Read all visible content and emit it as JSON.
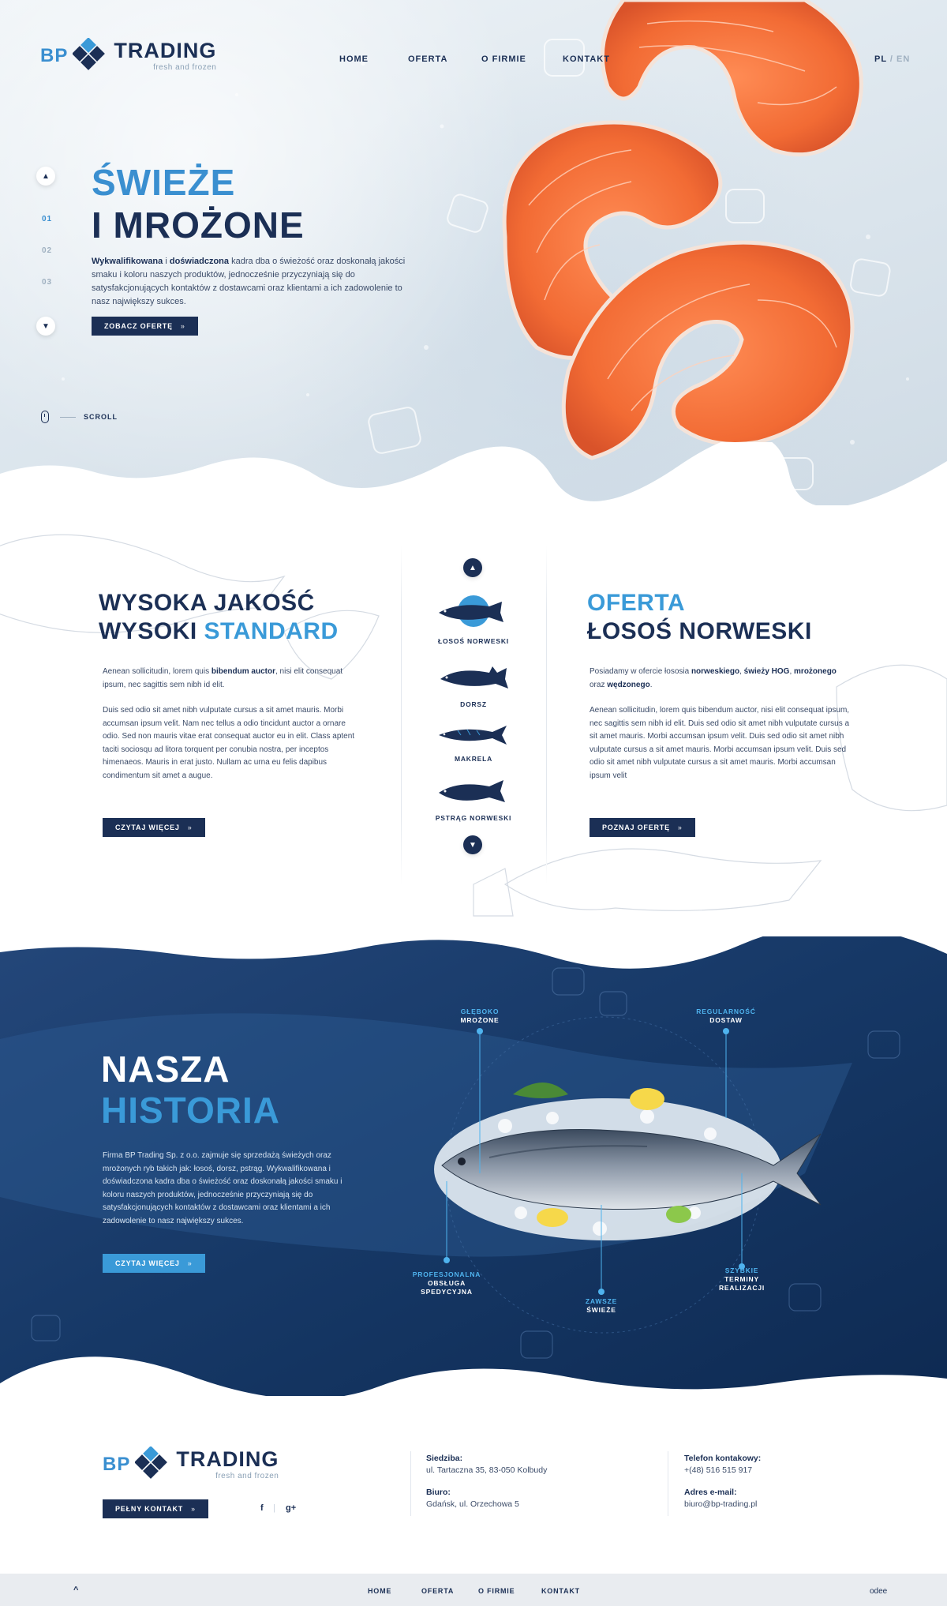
{
  "brand": {
    "bp": "BP",
    "trading": "TRADING",
    "tagline": "fresh and frozen",
    "colors": {
      "navy": "#1b2f55",
      "accent": "#3a9ad8",
      "light_accent": "#4fb3ee"
    }
  },
  "nav": {
    "items": [
      "HOME",
      "OFERTA",
      "O FIRMIE",
      "KONTAKT"
    ],
    "lang_pl": "PL",
    "lang_sep": "/",
    "lang_en": "EN"
  },
  "hero": {
    "title_line1": "ŚWIEŻE",
    "title_line2": "I MROŻONE",
    "text_bold1": "Wykwalifikowana",
    "text_mid1": " i ",
    "text_bold2": "doświadczona",
    "text_rest": " kadra dba o świeżość oraz doskonałą jakości smaku i koloru naszych produktów, jednocześnie przyczyniają się do satysfakcjonujących kontaktów z dostawcami oraz klientami a ich zadowolenie to nasz największy sukces.",
    "button": "ZOBACZ OFERTĘ",
    "slides": [
      "01",
      "02",
      "03"
    ],
    "scroll_label": "SCROLL"
  },
  "quality": {
    "title_line1": "WYSOKA JAKOŚĆ",
    "title_line2a": "WYSOKI ",
    "title_line2b": "STANDARD",
    "p1_start": "Aenean sollicitudin, lorem quis ",
    "p1_bold": "bibendum auctor",
    "p1_end": ", nisi elit consequat ipsum, nec sagittis sem nibh id elit.",
    "p2": "Duis sed odio sit amet nibh vulputate cursus a sit amet mauris. Morbi accumsan ipsum velit. Nam nec tellus a odio tincidunt auctor a ornare odio. Sed non  mauris vitae erat consequat auctor eu in elit. Class aptent taciti sociosqu ad litora torquent per conubia nostra, per inceptos himenaeos.  Mauris in erat justo. Nullam ac urna eu felis dapibus condimentum sit amet a augue.",
    "button": "CZYTAJ WIĘCEJ"
  },
  "fish": [
    "ŁOSOŚ NORWESKI",
    "DORSZ",
    "MAKRELA",
    "PSTRĄG NORWESKI"
  ],
  "offer": {
    "title_line1": "OFERTA",
    "title_line2": "ŁOSOŚ NORWESKI",
    "p1_a": "Posiadamy w ofercie łososia ",
    "p1_b": "norweskiego",
    "p1_c": ", ",
    "p1_d": "świeży HOG",
    "p1_e": ", ",
    "p1_f": "mrożonego",
    "p1_g": " oraz ",
    "p1_h": "wędzonego",
    "p1_i": ".",
    "p2": "Aenean sollicitudin, lorem quis bibendum auctor, nisi elit consequat ipsum, nec sagittis sem nibh id elit. Duis sed odio sit amet nibh vulputate cursus a sit amet mauris. Morbi accumsan ipsum velit. Duis sed odio sit amet nibh vulputate cursus a sit amet mauris. Morbi accumsan ipsum velit.  Duis sed odio sit amet nibh vulputate cursus a sit amet mauris. Morbi accumsan ipsum velit",
    "button": "POZNAJ OFERTĘ"
  },
  "history": {
    "title_line1": "NASZA",
    "title_line2": "HISTORIA",
    "text": "Firma BP Trading Sp. z o.o. zajmuje się sprzedażą świeżych oraz mrożonych ryb takich jak: łosoś, dorsz, pstrąg. Wykwalifikowana i doświadczona kadra dba o świeżość oraz doskonałą jakości smaku i koloru naszych produktów, jednocześnie przyczyniają się do satysfakcjonujących kontaktów z dostawcami oraz klientami a ich zadowolenie to nasz największy sukces.",
    "button": "CZYTAJ WIĘCEJ",
    "features": [
      {
        "a": "GŁĘBOKO",
        "b": "MROŻONE"
      },
      {
        "a": "REGULARNOŚĆ",
        "b": "DOSTAW"
      },
      {
        "a": "PROFESJONALNA",
        "b": "OBSŁUGA SPEDYCYJNA"
      },
      {
        "a": "ZAWSZE",
        "b": "ŚWIEŻE"
      },
      {
        "a": "SZYBKIE",
        "b": "TERMINY REALIZACJI"
      }
    ]
  },
  "footer": {
    "button": "PEŁNY KONTAKT",
    "social_f": "f",
    "social_sep": "|",
    "social_g": "g+",
    "seat_label": "Siedziba:",
    "seat_value": "ul. Tartaczna 35, 83-050 Kolbudy",
    "office_label": "Biuro:",
    "office_value": "Gdańsk, ul. Orzechowa 5",
    "phone_label": "Telefon kontakowy:",
    "phone_value": "+(48) 516 515 917",
    "email_label": "Adres e-mail:",
    "email_value": "biuro@bp-trading.pl",
    "bottom_nav": [
      "HOME",
      "OFERTA",
      "O FIRMIE",
      "KONTAKT"
    ],
    "credit": "odee",
    "up_arrow": "^"
  }
}
